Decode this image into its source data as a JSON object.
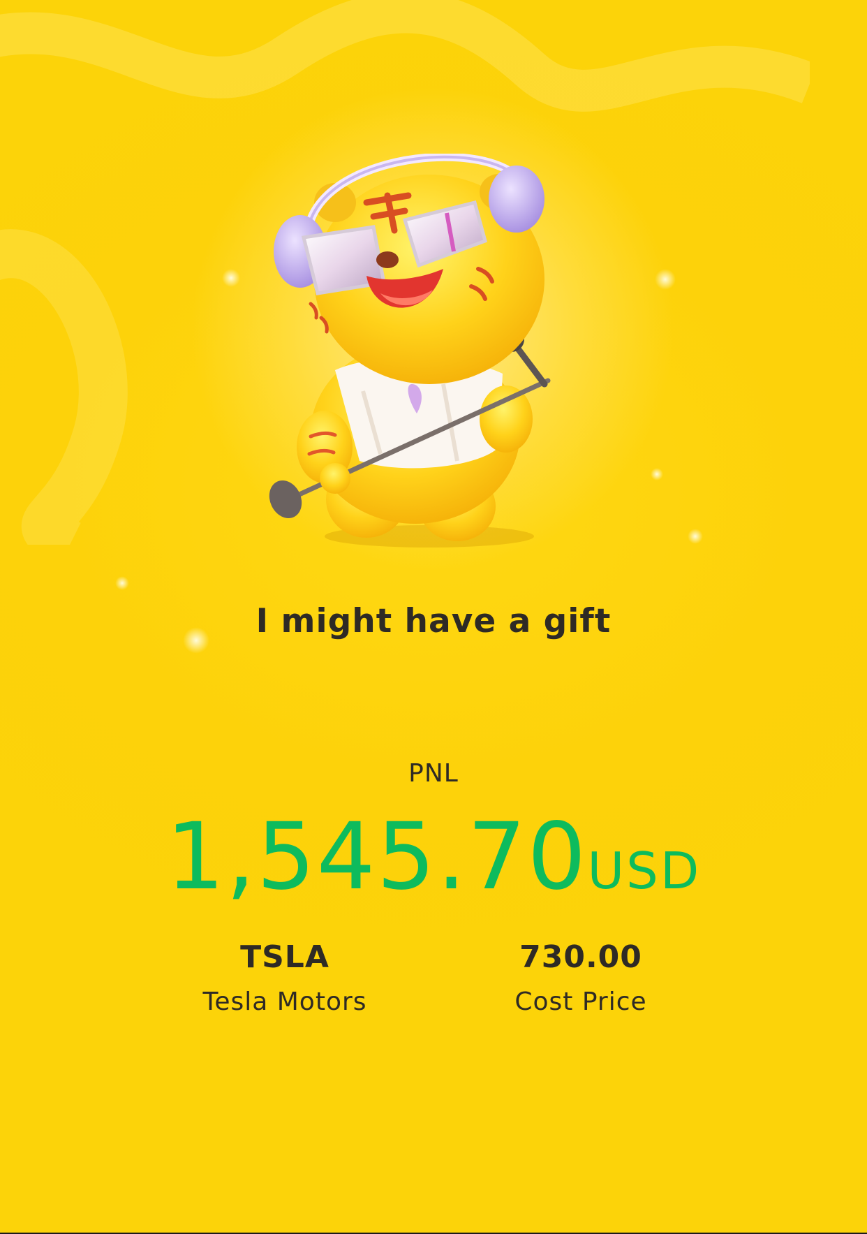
{
  "banner": {
    "headline": "I might have a gift"
  },
  "pnl": {
    "label": "PNL",
    "amount": "1,545.70",
    "currency": "USD",
    "color": "#0dbb5d"
  },
  "stock": {
    "ticker": "TSLA",
    "name": "Tesla Motors"
  },
  "cost": {
    "value": "730.00",
    "label": "Cost Price"
  },
  "colors": {
    "background": "#fdd20a",
    "text": "#2e2a25"
  }
}
